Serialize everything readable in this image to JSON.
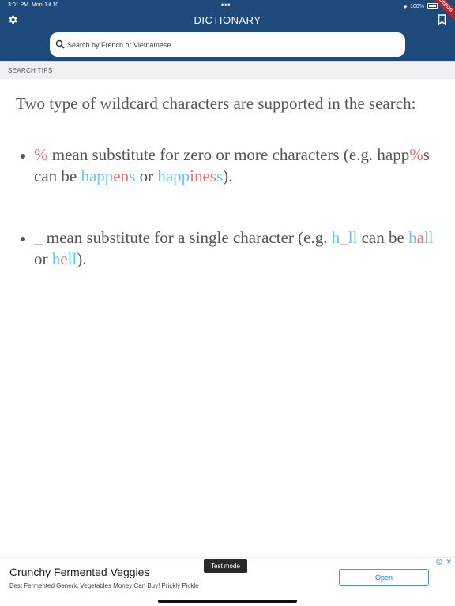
{
  "status_bar": {
    "time": "3:01 PM",
    "date": "Mon Jul 10",
    "battery": "100%",
    "dots": "•••",
    "debug": "DEBUG"
  },
  "header": {
    "title": "DICTIONARY",
    "settings_icon": "gear-icon",
    "bookmark_icon": "bookmark-icon"
  },
  "search": {
    "placeholder": "Search by French or Vietnamese"
  },
  "section": {
    "label": "SEARCH TIPS"
  },
  "content": {
    "intro": "Two type of wildcard characters are supported in the search:",
    "tip1": {
      "symbol": "%",
      "text1": " mean substitute for zero or more characters (e.g. ",
      "ex1a": "happ",
      "ex1b": "%",
      "ex1c": "s",
      "text2": " can be ",
      "ex2a": "happ",
      "ex2b": "en",
      "ex2c": "s",
      "text3": " or ",
      "ex3a": "happ",
      "ex3b": "ines",
      "ex3c": "s",
      "text4": ")."
    },
    "tip2": {
      "symbol": "_",
      "text1": " mean substitute for a single character (e.g. ",
      "ex1a": "h",
      "ex1b": "_",
      "ex1c": "ll",
      "text2": " can be ",
      "ex2a": "h",
      "ex2b": "a",
      "ex2c": "ll",
      "text3": " or ",
      "ex3a": "h",
      "ex3b": "e",
      "ex3c": "ll",
      "text4": ")."
    }
  },
  "ad": {
    "title": "Crunchy Fermented Veggies",
    "subtitle": "Best Fermented Generic Vegetables Money Can Buy! Prickly Pickle",
    "test_mode": "Test mode",
    "button": "Open",
    "close": "✕"
  },
  "colors": {
    "header": "#1d4a7a",
    "red": "#f26b6b",
    "blue": "#62c9ea"
  }
}
